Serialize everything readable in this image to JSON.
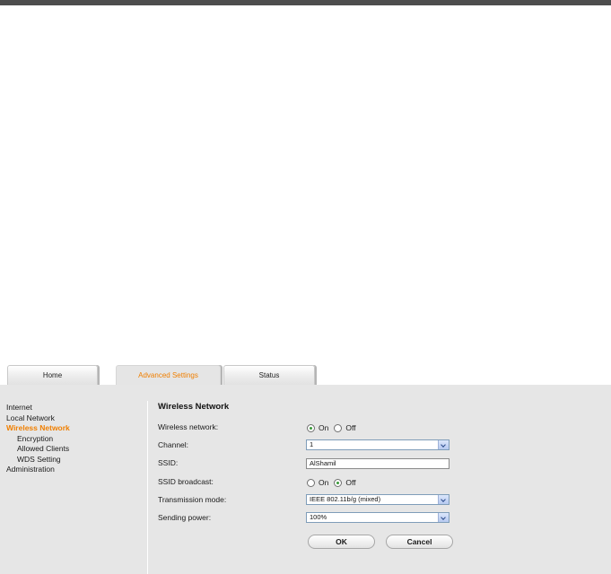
{
  "tabs": [
    {
      "label": "Home"
    },
    {
      "label": "Advanced Settings"
    },
    {
      "label": "Status"
    }
  ],
  "colors": {
    "accent": "#f07f00",
    "panel_bg": "#e6e6e6",
    "top_bar": "#4d4d4d"
  },
  "sidebar": {
    "items": [
      {
        "label": "Internet"
      },
      {
        "label": "Local Network"
      },
      {
        "label": "Wireless Network"
      },
      {
        "label": "Encryption"
      },
      {
        "label": "Allowed Clients"
      },
      {
        "label": "WDS Setting"
      },
      {
        "label": "Administration"
      }
    ]
  },
  "content": {
    "title": "Wireless Network",
    "wireless_network": {
      "label": "Wireless network:",
      "on": "On",
      "off": "Off",
      "selected": "On"
    },
    "channel": {
      "label": "Channel:",
      "value": "1"
    },
    "ssid": {
      "label": "SSID:",
      "value": "AlShamil"
    },
    "ssid_broadcast": {
      "label": "SSID broadcast:",
      "on": "On",
      "off": "Off",
      "selected": "Off"
    },
    "transmission_mode": {
      "label": "Transmission mode:",
      "value": "IEEE 802.11b/g (mixed)"
    },
    "sending_power": {
      "label": "Sending power:",
      "value": "100%"
    },
    "ok_label": "OK",
    "cancel_label": "Cancel"
  }
}
